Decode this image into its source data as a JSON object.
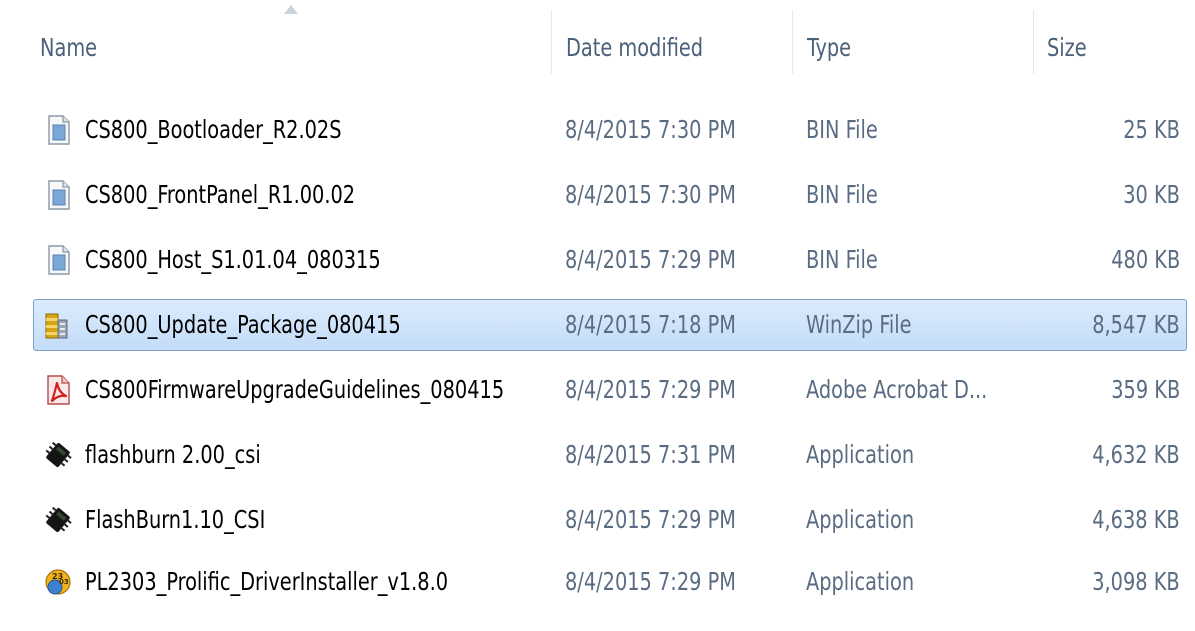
{
  "columns": {
    "name": "Name",
    "date": "Date modified",
    "type": "Type",
    "size": "Size"
  },
  "files": [
    {
      "name": "CS800_Bootloader_R2.02S",
      "date": "8/4/2015 7:30 PM",
      "type": "BIN File",
      "size": "25 KB",
      "icon": "bin-file-icon",
      "selected": false
    },
    {
      "name": "CS800_FrontPanel_R1.00.02",
      "date": "8/4/2015 7:30 PM",
      "type": "BIN File",
      "size": "30 KB",
      "icon": "bin-file-icon",
      "selected": false
    },
    {
      "name": "CS800_Host_S1.01.04_080315",
      "date": "8/4/2015 7:29 PM",
      "type": "BIN File",
      "size": "480 KB",
      "icon": "bin-file-icon",
      "selected": false
    },
    {
      "name": "CS800_Update_Package_080415",
      "date": "8/4/2015 7:18 PM",
      "type": "WinZip File",
      "size": "8,547 KB",
      "icon": "winzip-icon",
      "selected": true
    },
    {
      "name": "CS800FirmwareUpgradeGuidelines_080415",
      "date": "8/4/2015 7:29 PM",
      "type": "Adobe Acrobat D...",
      "size": "359 KB",
      "icon": "pdf-icon",
      "selected": false
    },
    {
      "name": "flashburn 2.00_csi",
      "date": "8/4/2015 7:31 PM",
      "type": "Application",
      "size": "4,632 KB",
      "icon": "chip-app-icon",
      "selected": false
    },
    {
      "name": "FlashBurn1.10_CSI",
      "date": "8/4/2015 7:29 PM",
      "type": "Application",
      "size": "4,638 KB",
      "icon": "chip-app-icon",
      "selected": false
    },
    {
      "name": "PL2303_Prolific_DriverInstaller_v1.8.0",
      "date": "8/4/2015 7:29 PM",
      "type": "Application",
      "size": "3,098 KB",
      "icon": "installer-icon",
      "selected": false
    }
  ],
  "colors": {
    "header_text": "#4c607a",
    "name_text": "#000000",
    "detail_text": "#5a6c82",
    "selection_fill": "#cde3fa",
    "selection_border": "#7da2ce"
  }
}
